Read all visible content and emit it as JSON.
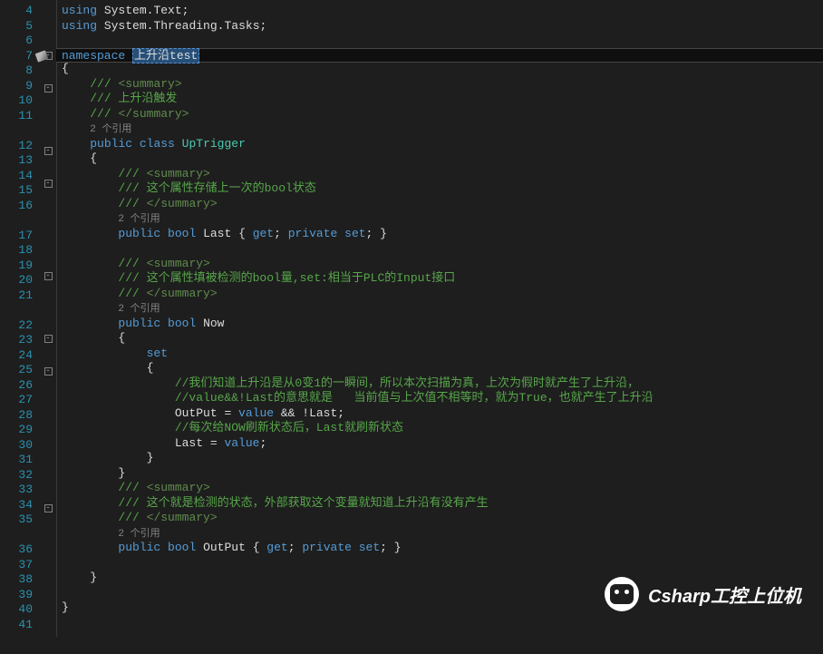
{
  "lines": [
    {
      "n": 4,
      "fold": "",
      "i": 0,
      "tokens": [
        [
          "kw",
          "using"
        ],
        [
          "punct",
          " "
        ],
        [
          "ident",
          "System"
        ],
        [
          "punct",
          "."
        ],
        [
          "ident",
          "Text"
        ],
        [
          "punct",
          ";"
        ]
      ]
    },
    {
      "n": 5,
      "fold": "",
      "i": 0,
      "tokens": [
        [
          "kw",
          "using"
        ],
        [
          "punct",
          " "
        ],
        [
          "ident",
          "System"
        ],
        [
          "punct",
          "."
        ],
        [
          "ident",
          "Threading"
        ],
        [
          "punct",
          "."
        ],
        [
          "ident",
          "Tasks"
        ],
        [
          "punct",
          ";"
        ]
      ]
    },
    {
      "n": 6,
      "fold": "",
      "i": 0,
      "tokens": []
    },
    {
      "n": 7,
      "fold": "box",
      "i": 0,
      "current": true,
      "marker": true,
      "tokens": [
        [
          "kw",
          "namespace"
        ],
        [
          "punct",
          " "
        ],
        [
          "sel",
          "上升沿test"
        ]
      ]
    },
    {
      "n": 8,
      "fold": "",
      "i": 0,
      "tokens": [
        [
          "punct",
          "{"
        ]
      ]
    },
    {
      "n": 9,
      "fold": "box",
      "i": 1,
      "tokens": [
        [
          "cm",
          "/// "
        ],
        [
          "xmlcm",
          "<summary>"
        ]
      ]
    },
    {
      "n": 10,
      "fold": "",
      "i": 1,
      "tokens": [
        [
          "cm",
          "/// 上升沿触发"
        ]
      ]
    },
    {
      "n": 11,
      "fold": "",
      "i": 1,
      "tokens": [
        [
          "cm",
          "/// "
        ],
        [
          "xmlcm",
          "</summary>"
        ]
      ]
    },
    {
      "n": "",
      "fold": "",
      "i": 1,
      "tokens": [
        [
          "ref",
          "2 个引用"
        ]
      ]
    },
    {
      "n": 12,
      "fold": "box",
      "i": 1,
      "tokens": [
        [
          "kw",
          "public"
        ],
        [
          "punct",
          " "
        ],
        [
          "kw",
          "class"
        ],
        [
          "punct",
          " "
        ],
        [
          "type",
          "UpTrigger"
        ]
      ]
    },
    {
      "n": 13,
      "fold": "",
      "i": 1,
      "tokens": [
        [
          "punct",
          "{"
        ]
      ]
    },
    {
      "n": 14,
      "fold": "box",
      "i": 2,
      "tokens": [
        [
          "cm",
          "/// "
        ],
        [
          "xmlcm",
          "<summary>"
        ]
      ]
    },
    {
      "n": 15,
      "fold": "",
      "i": 2,
      "tokens": [
        [
          "cm",
          "/// 这个属性存储上一次的bool状态"
        ]
      ]
    },
    {
      "n": 16,
      "fold": "",
      "i": 2,
      "tokens": [
        [
          "cm",
          "/// "
        ],
        [
          "xmlcm",
          "</summary>"
        ]
      ]
    },
    {
      "n": "",
      "fold": "",
      "i": 2,
      "tokens": [
        [
          "ref",
          "2 个引用"
        ]
      ]
    },
    {
      "n": 17,
      "fold": "",
      "i": 2,
      "tokens": [
        [
          "kw",
          "public"
        ],
        [
          "punct",
          " "
        ],
        [
          "kw",
          "bool"
        ],
        [
          "punct",
          " "
        ],
        [
          "ident",
          "Last"
        ],
        [
          "punct",
          " { "
        ],
        [
          "kw",
          "get"
        ],
        [
          "punct",
          "; "
        ],
        [
          "kw",
          "private"
        ],
        [
          "punct",
          " "
        ],
        [
          "kw",
          "set"
        ],
        [
          "punct",
          "; }"
        ]
      ]
    },
    {
      "n": 18,
      "fold": "",
      "i": 2,
      "tokens": []
    },
    {
      "n": 19,
      "fold": "box",
      "i": 2,
      "tokens": [
        [
          "cm",
          "/// "
        ],
        [
          "xmlcm",
          "<summary>"
        ]
      ]
    },
    {
      "n": 20,
      "fold": "",
      "i": 2,
      "tokens": [
        [
          "cm",
          "/// 这个属性填被检测的bool量,set:相当于PLC的Input接口"
        ]
      ]
    },
    {
      "n": 21,
      "fold": "",
      "i": 2,
      "tokens": [
        [
          "cm",
          "/// "
        ],
        [
          "xmlcm",
          "</summary>"
        ]
      ]
    },
    {
      "n": "",
      "fold": "",
      "i": 2,
      "tokens": [
        [
          "ref",
          "2 个引用"
        ]
      ]
    },
    {
      "n": 22,
      "fold": "box",
      "i": 2,
      "tokens": [
        [
          "kw",
          "public"
        ],
        [
          "punct",
          " "
        ],
        [
          "kw",
          "bool"
        ],
        [
          "punct",
          " "
        ],
        [
          "ident",
          "Now"
        ]
      ]
    },
    {
      "n": 23,
      "fold": "",
      "i": 2,
      "tokens": [
        [
          "punct",
          "{"
        ]
      ]
    },
    {
      "n": 24,
      "fold": "box",
      "i": 3,
      "tokens": [
        [
          "kw",
          "set"
        ]
      ]
    },
    {
      "n": 25,
      "fold": "",
      "i": 3,
      "tokens": [
        [
          "punct",
          "{"
        ]
      ]
    },
    {
      "n": 26,
      "fold": "",
      "i": 4,
      "tokens": [
        [
          "cm",
          "//我们知道上升沿是从0变1的一瞬间，所以本次扫描为真，上次为假时就产生了上升沿，"
        ]
      ]
    },
    {
      "n": 27,
      "fold": "",
      "i": 4,
      "tokens": [
        [
          "cm",
          "//value&&!Last的意思就是   当前值与上次值不相等时，就为True，也就产生了上升沿"
        ]
      ]
    },
    {
      "n": 28,
      "fold": "",
      "i": 4,
      "tokens": [
        [
          "ident",
          "OutPut"
        ],
        [
          "punct",
          " = "
        ],
        [
          "kw",
          "value"
        ],
        [
          "punct",
          " && !"
        ],
        [
          "ident",
          "Last"
        ],
        [
          "punct",
          ";"
        ]
      ]
    },
    {
      "n": 29,
      "fold": "",
      "i": 4,
      "tokens": [
        [
          "cm",
          "//每次给NOW刷新状态后，Last就刷新状态"
        ]
      ]
    },
    {
      "n": 30,
      "fold": "",
      "i": 4,
      "tokens": [
        [
          "ident",
          "Last"
        ],
        [
          "punct",
          " = "
        ],
        [
          "kw",
          "value"
        ],
        [
          "punct",
          ";"
        ]
      ]
    },
    {
      "n": 31,
      "fold": "",
      "i": 3,
      "tokens": [
        [
          "punct",
          "}"
        ]
      ]
    },
    {
      "n": 32,
      "fold": "",
      "i": 2,
      "tokens": [
        [
          "punct",
          "}"
        ]
      ]
    },
    {
      "n": 33,
      "fold": "box",
      "i": 2,
      "tokens": [
        [
          "cm",
          "/// "
        ],
        [
          "xmlcm",
          "<summary>"
        ]
      ]
    },
    {
      "n": 34,
      "fold": "",
      "i": 2,
      "tokens": [
        [
          "cm",
          "/// 这个就是检测的状态，外部获取这个变量就知道上升沿有没有产生"
        ]
      ]
    },
    {
      "n": 35,
      "fold": "",
      "i": 2,
      "tokens": [
        [
          "cm",
          "/// "
        ],
        [
          "xmlcm",
          "</summary>"
        ]
      ]
    },
    {
      "n": "",
      "fold": "",
      "i": 2,
      "tokens": [
        [
          "ref",
          "2 个引用"
        ]
      ]
    },
    {
      "n": 36,
      "fold": "",
      "i": 2,
      "tokens": [
        [
          "kw",
          "public"
        ],
        [
          "punct",
          " "
        ],
        [
          "kw",
          "bool"
        ],
        [
          "punct",
          " "
        ],
        [
          "ident",
          "OutPut"
        ],
        [
          "punct",
          " { "
        ],
        [
          "kw",
          "get"
        ],
        [
          "punct",
          "; "
        ],
        [
          "kw",
          "private"
        ],
        [
          "punct",
          " "
        ],
        [
          "kw",
          "set"
        ],
        [
          "punct",
          "; }"
        ]
      ]
    },
    {
      "n": 37,
      "fold": "",
      "i": 2,
      "tokens": []
    },
    {
      "n": 38,
      "fold": "",
      "i": 1,
      "tokens": [
        [
          "punct",
          "}"
        ]
      ]
    },
    {
      "n": 39,
      "fold": "",
      "i": 1,
      "tokens": []
    },
    {
      "n": 40,
      "fold": "",
      "i": 0,
      "tokens": [
        [
          "punct",
          "}"
        ]
      ]
    },
    {
      "n": 41,
      "fold": "",
      "i": 0,
      "tokens": []
    }
  ],
  "watermark": {
    "text": "Csharp工控上位机"
  }
}
